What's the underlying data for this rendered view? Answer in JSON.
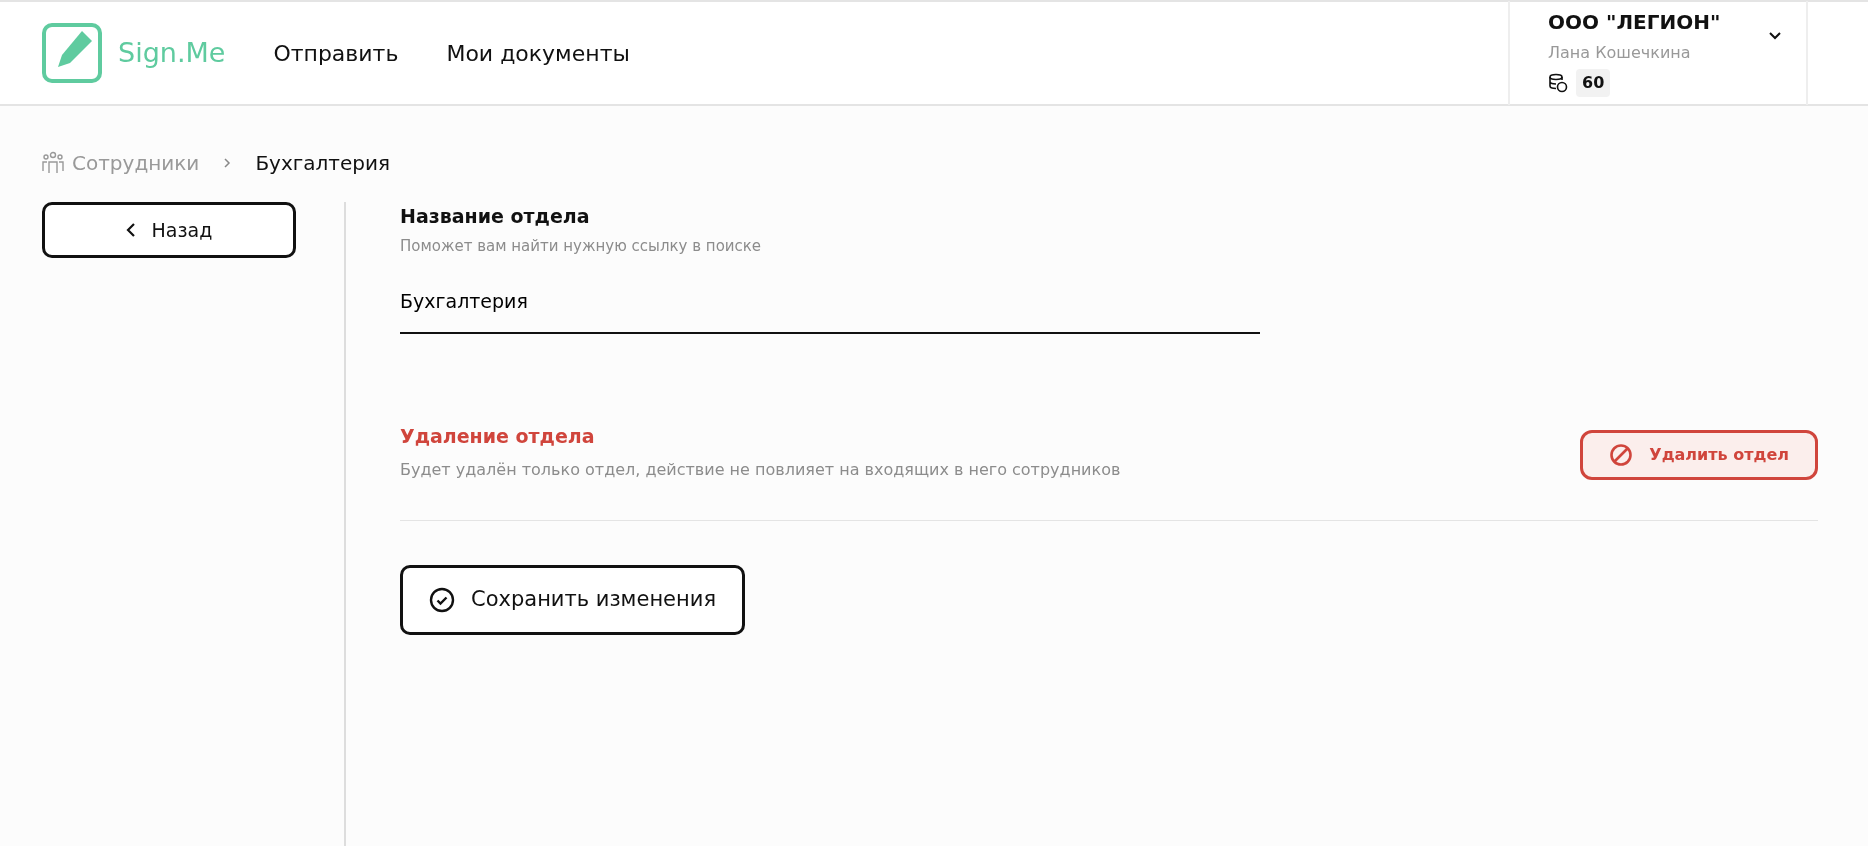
{
  "header": {
    "logo_text": "Sign.Me",
    "nav": [
      {
        "label": "Отправить"
      },
      {
        "label": "Мои документы"
      }
    ],
    "account": {
      "company": "ООО \"ЛЕГИОН\"",
      "user": "Лана Кошечкина",
      "balance": "60"
    }
  },
  "breadcrumbs": [
    {
      "label": "Сотрудники",
      "kind": "link"
    },
    {
      "label": "Бухгалтерия",
      "kind": "current"
    }
  ],
  "back_button": "Назад",
  "name_section": {
    "title": "Название отдела",
    "hint": "Поможет вам найти нужную ссылку в поиске",
    "value": "Бухгалтерия"
  },
  "delete_section": {
    "title": "Удаление отдела",
    "description": "Будет удалён только отдел, действие не повлияет на входящих в него сотрудников",
    "button": "Удалить отдел"
  },
  "save_button": "Сохранить изменения"
}
